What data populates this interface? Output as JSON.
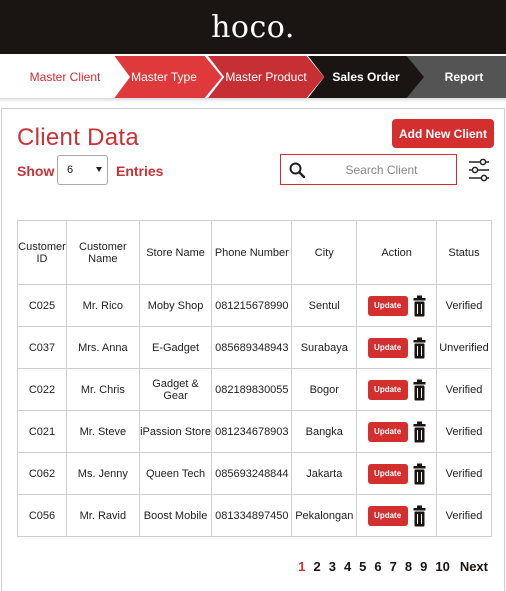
{
  "brand": {
    "logo": "hoco."
  },
  "steps": [
    {
      "label": "Master Client",
      "active": true
    },
    {
      "label": "Master Type"
    },
    {
      "label": "Master Product"
    },
    {
      "label": "Sales Order"
    },
    {
      "label": "Report"
    }
  ],
  "page": {
    "title": "Client Data",
    "add_button": "Add New Client",
    "show_label": "Show",
    "entries_value": "6",
    "entries_label": "Entries",
    "search_placeholder": "Search Client"
  },
  "colors": {
    "accent": "#d32f2f",
    "dark": "#1a1412",
    "verified": "#3aaa35",
    "unverified": "#d32f2f"
  },
  "table": {
    "headers": [
      "Customer ID",
      "Customer Name",
      "Store Name",
      "Phone Number",
      "City",
      "Action",
      "Status"
    ],
    "update_label": "Update",
    "rows": [
      {
        "id": "C025",
        "name": "Mr. Rico",
        "store": "Moby Shop",
        "phone": "081215678990",
        "city": "Sentul",
        "status": "Verified"
      },
      {
        "id": "C037",
        "name": "Mrs. Anna",
        "store": "E-Gadget",
        "phone": "085689348943",
        "city": "Surabaya",
        "status": "Unverified"
      },
      {
        "id": "C022",
        "name": "Mr. Chris",
        "store": "Gadget & Gear",
        "phone": "082189830055",
        "city": "Bogor",
        "status": "Verified"
      },
      {
        "id": "C021",
        "name": "Mr. Steve",
        "store": "iPassion Store",
        "phone": "081234678903",
        "city": "Bangka",
        "status": "Verified"
      },
      {
        "id": "C062",
        "name": "Ms. Jenny",
        "store": "Queen Tech",
        "phone": "085693248844",
        "city": "Jakarta",
        "status": "Verified"
      },
      {
        "id": "C056",
        "name": "Mr. Ravid",
        "store": "Boost Mobile",
        "phone": "081334897450",
        "city": "Pekalongan",
        "status": "Verified"
      }
    ]
  },
  "pagination": {
    "pages": [
      "1",
      "2",
      "3",
      "4",
      "5",
      "6",
      "7",
      "8",
      "9",
      "10"
    ],
    "current": "1",
    "next": "Next"
  }
}
